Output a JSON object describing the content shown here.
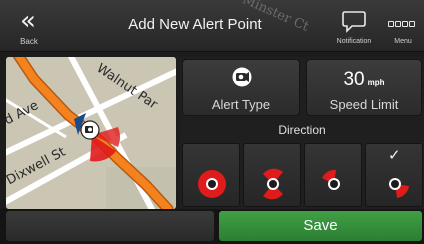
{
  "header": {
    "back_label": "Back",
    "back_glyph": "«",
    "title": "Add New Alert Point",
    "ghost_street": "Minster Ct",
    "notification_label": "Notification",
    "menu_label": "Menu"
  },
  "map": {
    "streets": [
      "Walnut Par",
      "d Ave",
      "Dixwell St"
    ]
  },
  "alert_type": {
    "label": "Alert Type",
    "icon": "speed-camera-icon"
  },
  "speed_limit": {
    "value": "30",
    "unit": "mph",
    "label": "Speed Limit"
  },
  "direction": {
    "label": "Direction",
    "options": [
      {
        "name": "all-directions",
        "selected": false
      },
      {
        "name": "both-directions",
        "selected": false
      },
      {
        "name": "one-direction",
        "selected": false
      },
      {
        "name": "opposite-direction",
        "selected": true
      }
    ],
    "check_glyph": "✓"
  },
  "footer": {
    "save_label": "Save"
  },
  "colors": {
    "route": "#f4831f",
    "alert_red": "#e01b1b",
    "save_green": "#36963c",
    "map_bg": "#cbc6b4"
  }
}
